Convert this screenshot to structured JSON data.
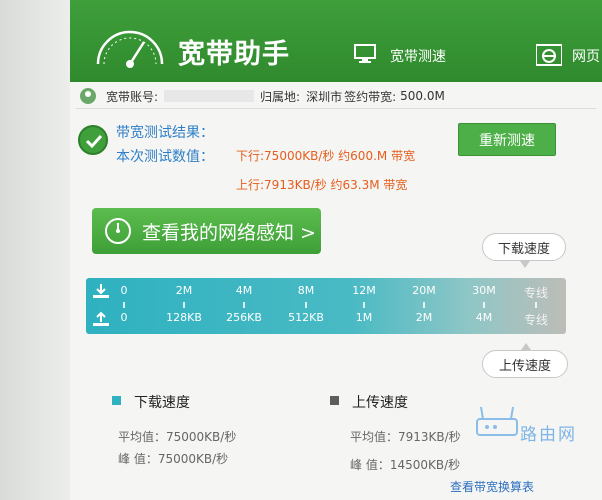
{
  "header": {
    "title": "宽带助手",
    "nav": {
      "speed_test": "宽带测速",
      "web": "网页"
    }
  },
  "account": {
    "account_label": "宽带账号:",
    "location_label": "归属地:",
    "location_value": "深圳市",
    "contract_label": "签约带宽:",
    "contract_value": "500.0M"
  },
  "result": {
    "title": "带宽测试结果：",
    "subtitle": "本次测试数值：",
    "download_text": "下行:75000KB/秒 约600.M 带宽",
    "upload_text": "上行:7913KB/秒 约63.3M 带宽",
    "retest_label": "重新测速"
  },
  "perception_button": "查看我的网络感知 >",
  "callouts": {
    "download": "下载速度",
    "upload": "上传速度"
  },
  "speedbar": {
    "download_ticks": [
      "0",
      "2M",
      "4M",
      "8M",
      "12M",
      "20M",
      "30M",
      "专线"
    ],
    "upload_ticks": [
      "0",
      "128KB",
      "256KB",
      "512KB",
      "1M",
      "2M",
      "4M",
      "专线"
    ]
  },
  "legend": {
    "download": {
      "title": "下载速度",
      "avg": "平均值：75000KB/秒",
      "peak": "峰 值：75000KB/秒",
      "color": "#2fb1c0"
    },
    "upload": {
      "title": "上传速度",
      "avg": "平均值：7913KB/秒",
      "peak": "峰 值：14500KB/秒",
      "color": "#5d5d5d"
    }
  },
  "bandwidth_table_link": "查看带宽换算表",
  "watermark": "路由网",
  "colors": {
    "header_green": "#3f9f3b",
    "accent_blue": "#2e7fc7",
    "result_orange": "#e65d1e"
  },
  "icons": [
    "gauge-icon",
    "monitor-icon",
    "ie-icon",
    "user-icon",
    "check-icon",
    "clock-icon",
    "download-icon",
    "upload-icon",
    "router-icon"
  ]
}
